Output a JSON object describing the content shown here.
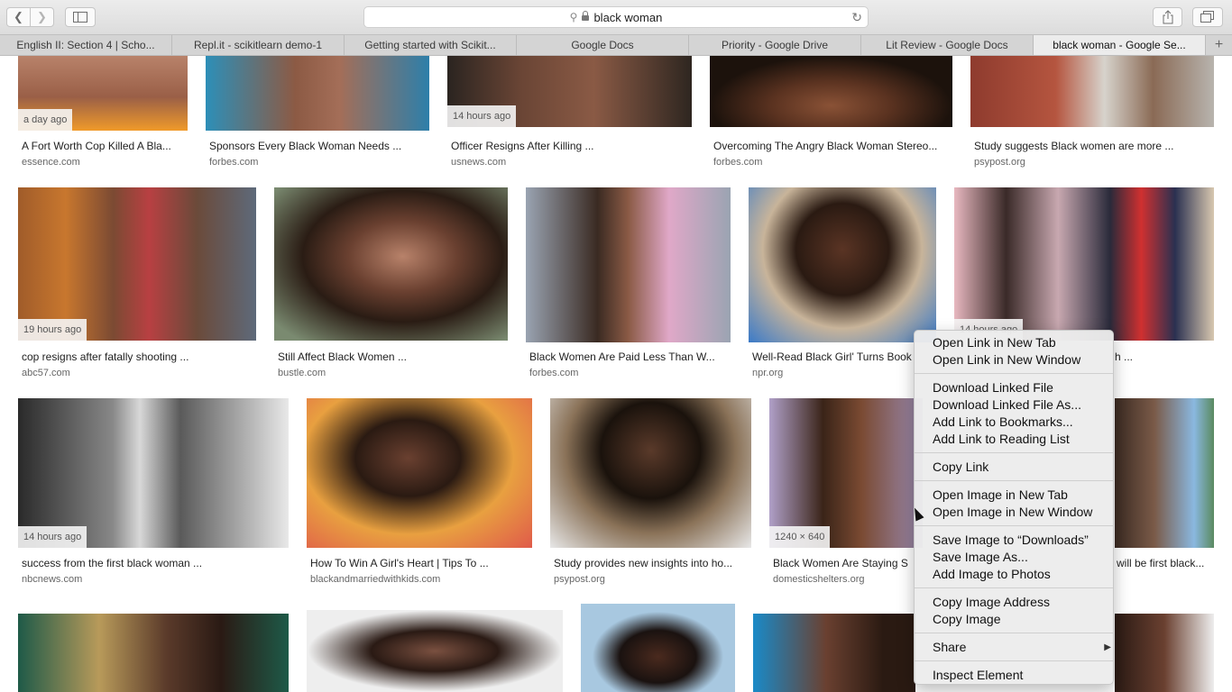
{
  "browser": {
    "address": "black woman",
    "tabs": [
      {
        "label": "English II: Section 4 | Scho..."
      },
      {
        "label": "Repl.it - scikitlearn demo-1"
      },
      {
        "label": "Getting started with Scikit..."
      },
      {
        "label": "Google Docs"
      },
      {
        "label": "Priority - Google Drive"
      },
      {
        "label": "Lit Review - Google Docs"
      },
      {
        "label": "black woman - Google Se..."
      }
    ],
    "new_tab_icon": "+"
  },
  "results": {
    "row1": [
      {
        "age": "a day ago",
        "title": "A Fort Worth Cop Killed A Bla...",
        "source": "essence.com"
      },
      {
        "age": "",
        "title": "Sponsors Every Black Woman Needs ...",
        "source": "forbes.com"
      },
      {
        "age": "14 hours ago",
        "title": "Officer Resigns After Killing ...",
        "source": "usnews.com"
      },
      {
        "age": "",
        "title": "Overcoming The Angry Black Woman Stereo...",
        "source": "forbes.com"
      },
      {
        "age": "",
        "title": "Study suggests Black women are more ...",
        "source": "psypost.org"
      }
    ],
    "row2": [
      {
        "age": "19 hours ago",
        "title": "cop resigns after fatally shooting ...",
        "source": "abc57.com"
      },
      {
        "age": "",
        "title": "Still Affect Black Women ...",
        "source": "bustle.com"
      },
      {
        "age": "",
        "title": "Black Women Are Paid Less Than W...",
        "source": "forbes.com"
      },
      {
        "age": "",
        "title": "Well-Read Black Girl' Turns Book",
        "source": "npr.org"
      },
      {
        "age": "14 hours ago",
        "title": "h ...",
        "source": ""
      }
    ],
    "row3": [
      {
        "age": "14 hours ago",
        "title": "success from the first black woman ...",
        "source": "nbcnews.com"
      },
      {
        "age": "",
        "title": "How To Win A Girl's Heart | Tips To ...",
        "source": "blackandmarriedwithkids.com"
      },
      {
        "age": "",
        "title": "Study provides new insights into ho...",
        "source": "psypost.org"
      },
      {
        "age": "1240 × 640",
        "title": "Black Women Are Staying S",
        "source": "domesticshelters.org"
      },
      {
        "age": "",
        "title": "will be first black...",
        "source": ""
      }
    ]
  },
  "context_menu": {
    "items": [
      "Open Link in New Tab",
      "Open Link in New Window",
      "Download Linked File",
      "Download Linked File As...",
      "Add Link to Bookmarks...",
      "Add Link to Reading List",
      "Copy Link",
      "Open Image in New Tab",
      "Open Image in New Window",
      "Save Image to “Downloads”",
      "Save Image As...",
      "Add Image to Photos",
      "Copy Image Address",
      "Copy Image",
      "Share",
      "Inspect Element"
    ]
  }
}
